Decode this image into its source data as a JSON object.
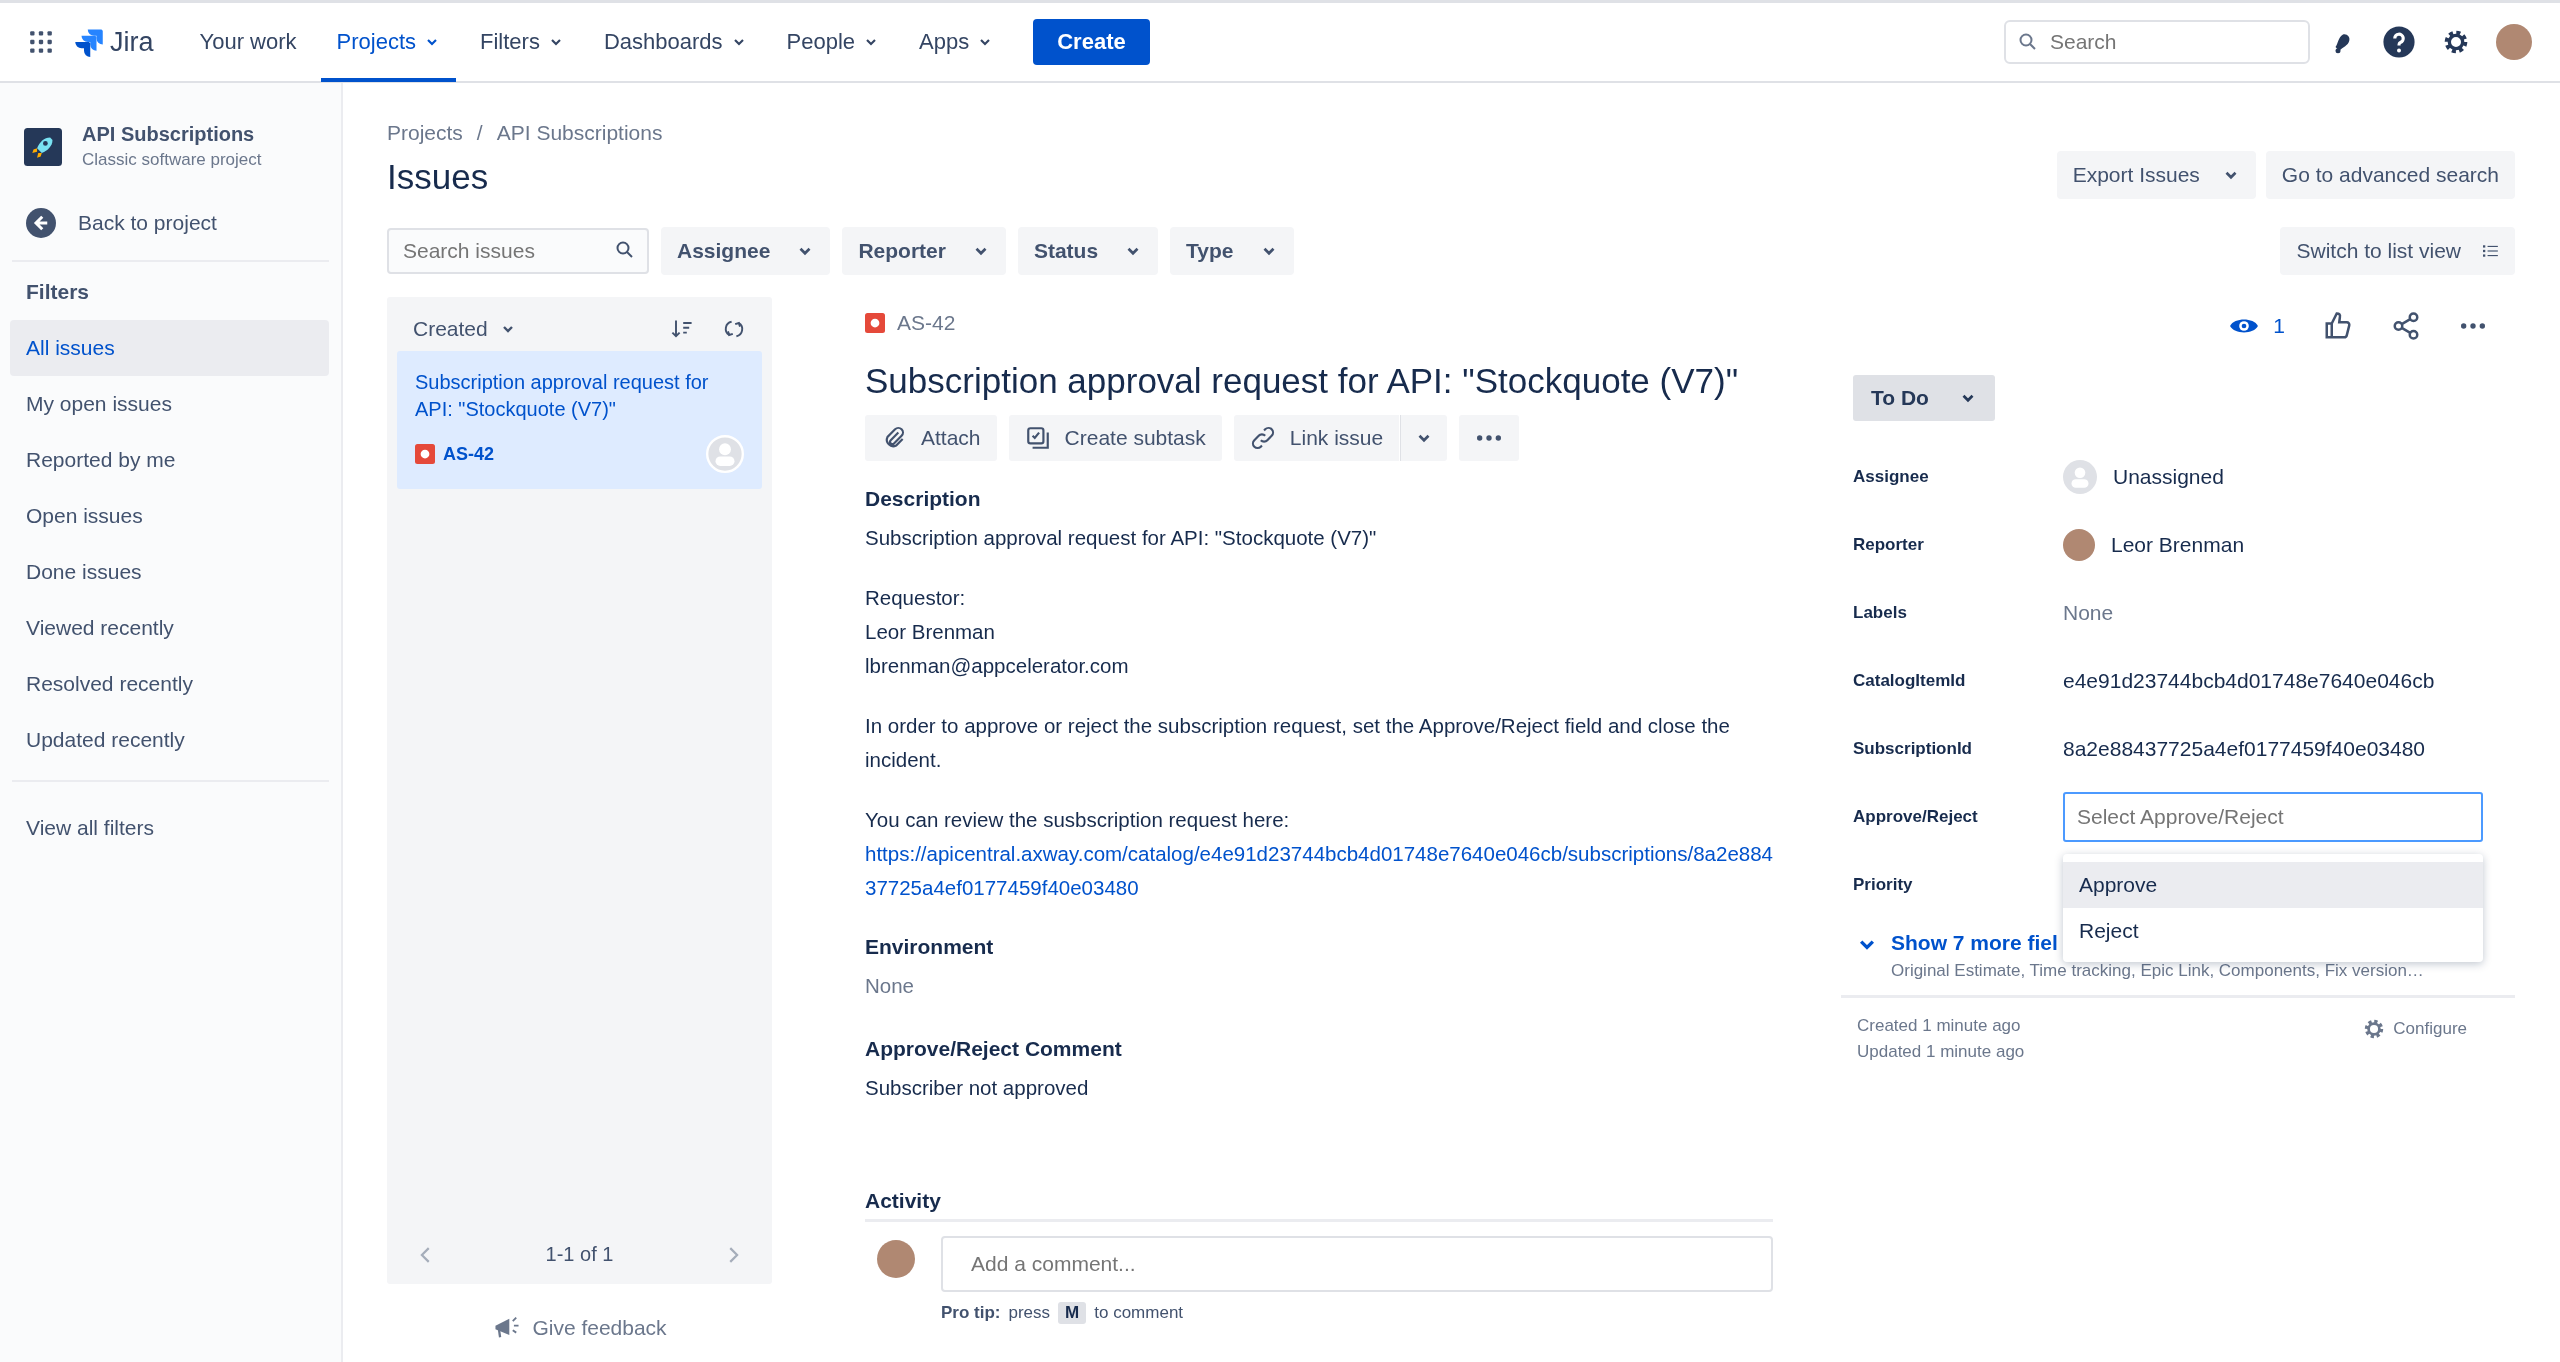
{
  "topnav": {
    "logo": "Jira",
    "items": [
      {
        "label": "Your work",
        "selected": false,
        "dropdown": false
      },
      {
        "label": "Projects",
        "selected": true,
        "dropdown": true
      },
      {
        "label": "Filters",
        "selected": false,
        "dropdown": true
      },
      {
        "label": "Dashboards",
        "selected": false,
        "dropdown": true
      },
      {
        "label": "People",
        "selected": false,
        "dropdown": true
      },
      {
        "label": "Apps",
        "selected": false,
        "dropdown": true
      }
    ],
    "create": "Create",
    "search": {
      "placeholder": "Search"
    }
  },
  "sidebar": {
    "project": {
      "name": "API Subscriptions",
      "type": "Classic software project"
    },
    "back": "Back to project",
    "filters_heading": "Filters",
    "items": [
      {
        "label": "All issues",
        "selected": true
      },
      {
        "label": "My open issues",
        "selected": false
      },
      {
        "label": "Reported by me",
        "selected": false
      },
      {
        "label": "Open issues",
        "selected": false
      },
      {
        "label": "Done issues",
        "selected": false
      },
      {
        "label": "Viewed recently",
        "selected": false
      },
      {
        "label": "Resolved recently",
        "selected": false
      },
      {
        "label": "Updated recently",
        "selected": false
      }
    ],
    "view_all": "View all filters"
  },
  "breadcrumbs": [
    "Projects",
    "API Subscriptions"
  ],
  "breadcrumb_separator": "/",
  "page_title": "Issues",
  "header_buttons": [
    {
      "label": "Export Issues",
      "dropdown": true
    },
    {
      "label": "Go to advanced search",
      "dropdown": false
    }
  ],
  "filter_bar": {
    "search": {
      "placeholder": "Search issues"
    },
    "dropdowns": [
      "Assignee",
      "Reporter",
      "Status",
      "Type"
    ],
    "switch_view": "Switch to list view"
  },
  "issue_list": {
    "sort": "Created",
    "items": [
      {
        "title": "Subscription approval request for API: \"Stockquote (V7)\"",
        "key": "AS-42",
        "selected": true
      }
    ],
    "pagination": "1-1 of 1"
  },
  "feedback": "Give feedback",
  "issue": {
    "key": "AS-42",
    "title": "Subscription approval request for API: \"Stockquote (V7)\"",
    "actions": [
      "Attach",
      "Create subtask",
      "Link issue"
    ],
    "description": {
      "heading": "Description",
      "paragraphs": [
        [
          "Subscription approval request for API: \"Stockquote (V7)\""
        ],
        [
          "Requestor:",
          "Leor Brenman",
          "lbrenman@appcelerator.com"
        ],
        [
          "In order to approve or reject the subscription request, set the Approve/Reject field and close the incident."
        ],
        [
          "You can review the susbscription request here:"
        ]
      ],
      "link": "https://apicentral.axway.com/catalog/e4e91d23744bcb4d01748e7640e046cb/subscriptions/8a2e88437725a4ef0177459f40e03480"
    },
    "sections": [
      {
        "heading": "Environment",
        "value": "None",
        "empty": true
      },
      {
        "heading": "Approve/Reject Comment",
        "value": "Subscriber not approved",
        "empty": false
      }
    ],
    "activity": {
      "heading": "Activity",
      "comment_placeholder": "Add a comment...",
      "tip_label": "Pro tip:",
      "tip_before": "press",
      "tip_key": "M",
      "tip_after": "to comment"
    }
  },
  "details": {
    "watchers": "1",
    "status": "To Do",
    "fields": [
      {
        "label": "Assignee",
        "kind": "unassigned_user",
        "value": "Unassigned"
      },
      {
        "label": "Reporter",
        "kind": "user",
        "value": "Leor Brenman"
      },
      {
        "label": "Labels",
        "kind": "empty",
        "value": "None"
      },
      {
        "label": "CatalogItemId",
        "kind": "text",
        "value": "e4e91d23744bcb4d01748e7640e046cb"
      },
      {
        "label": "SubscriptionId",
        "kind": "text",
        "value": "8a2e88437725a4ef0177459f40e03480"
      },
      {
        "label": "Approve/Reject",
        "kind": "select",
        "placeholder": "Select Approve/Reject",
        "options": [
          {
            "label": "Approve",
            "selected": true
          },
          {
            "label": "Reject",
            "selected": false
          }
        ]
      },
      {
        "label": "Priority",
        "kind": "text"
      }
    ],
    "show_more": "Show 7 more fiel",
    "show_more_hint": "Original Estimate, Time tracking, Epic Link, Components, Fix version…",
    "created": "Created 1 minute ago",
    "updated": "Updated 1 minute ago",
    "configure": "Configure"
  }
}
